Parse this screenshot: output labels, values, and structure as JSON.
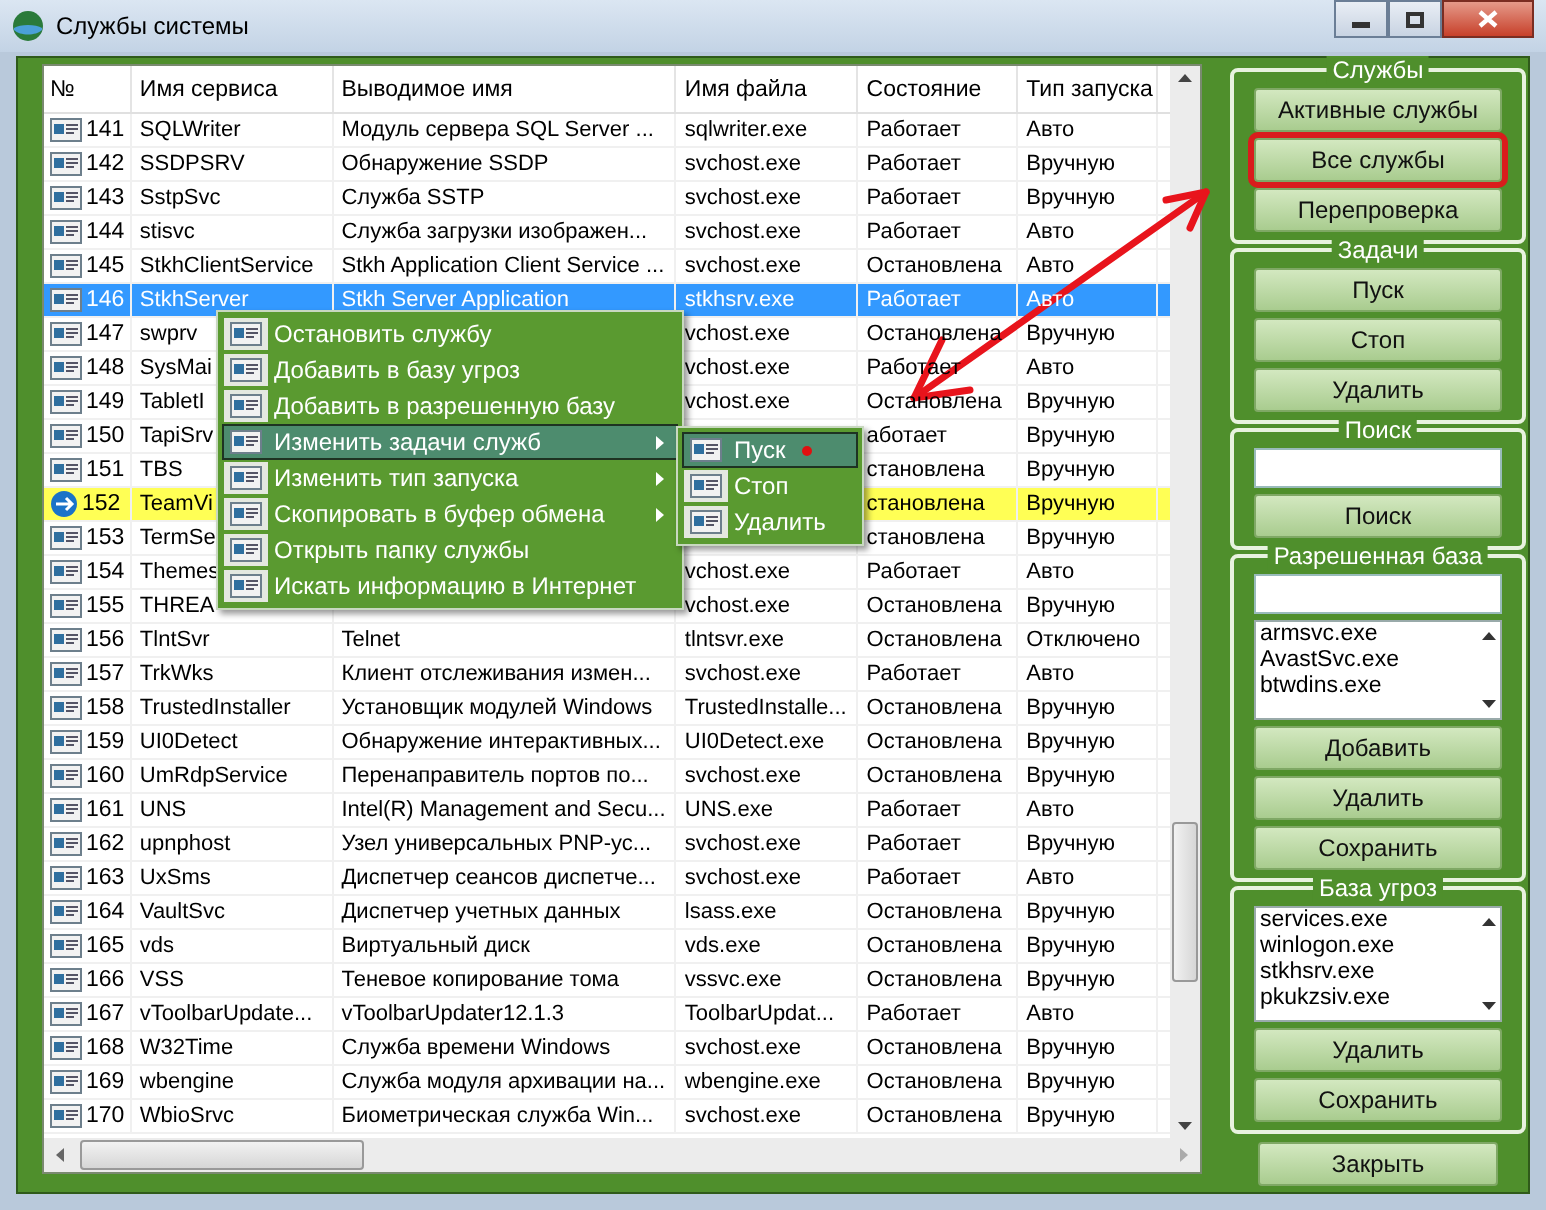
{
  "window": {
    "title": "Службы системы"
  },
  "table": {
    "columns": [
      "№",
      "Имя сервиса",
      "Выводимое имя",
      "Имя файла",
      "Состояние",
      "Тип запуска"
    ],
    "rows": [
      {
        "no": "141",
        "kind": "service",
        "name": "SQLWriter",
        "display": "Модуль сервера SQL Server ...",
        "file": "sqlwriter.exe",
        "state": "Работает",
        "startup": "Авто",
        "selected": false,
        "highlighted": false
      },
      {
        "no": "142",
        "kind": "service",
        "name": "SSDPSRV",
        "display": "Обнаружение SSDP",
        "file": "svchost.exe",
        "state": "Работает",
        "startup": "Вручную",
        "selected": false,
        "highlighted": false
      },
      {
        "no": "143",
        "kind": "service",
        "name": "SstpSvc",
        "display": "Служба SSTP",
        "file": "svchost.exe",
        "state": "Работает",
        "startup": "Вручную",
        "selected": false,
        "highlighted": false
      },
      {
        "no": "144",
        "kind": "service",
        "name": "stisvc",
        "display": "Служба загрузки изображен...",
        "file": "svchost.exe",
        "state": "Работает",
        "startup": "Авто",
        "selected": false,
        "highlighted": false
      },
      {
        "no": "145",
        "kind": "service",
        "name": "StkhClientService",
        "display": "Stkh Application Client Service ...",
        "file": "svchost.exe",
        "state": "Остановлена",
        "startup": "Авто",
        "selected": false,
        "highlighted": false
      },
      {
        "no": "146",
        "kind": "service",
        "name": "StkhServer",
        "display": "Stkh Server Application",
        "file": "stkhsrv.exe",
        "state": "Работает",
        "startup": "Авто",
        "selected": true,
        "highlighted": false
      },
      {
        "no": "147",
        "kind": "service",
        "name": "swprv",
        "file": "vchost.exe",
        "state": "Остановлена",
        "startup": "Вручную",
        "selected": false,
        "highlighted": false
      },
      {
        "no": "148",
        "kind": "service",
        "name": "SysMai",
        "file": "vchost.exe",
        "state": "Работает",
        "startup": "Авто",
        "selected": false,
        "highlighted": false
      },
      {
        "no": "149",
        "kind": "service",
        "name": "TabletI",
        "file": "vchost.exe",
        "state": "Остановлена",
        "startup": "Вручную",
        "selected": false,
        "highlighted": false
      },
      {
        "no": "150",
        "kind": "service",
        "name": "TapiSrv",
        "state": "аботает",
        "startup": "Вручную",
        "selected": false,
        "highlighted": false
      },
      {
        "no": "151",
        "kind": "service",
        "name": "TBS",
        "state": "становлена",
        "startup": "Вручную",
        "selected": false,
        "highlighted": false
      },
      {
        "no": "152",
        "kind": "app",
        "name": "TeamVi",
        "state": "становлена",
        "startup": "Вручную",
        "selected": false,
        "highlighted": true
      },
      {
        "no": "153",
        "kind": "service",
        "name": "TermSe",
        "state": "становлена",
        "startup": "Вручную",
        "selected": false,
        "highlighted": false
      },
      {
        "no": "154",
        "kind": "service",
        "name": "Themes",
        "file": "vchost.exe",
        "state": "Работает",
        "startup": "Авто",
        "selected": false,
        "highlighted": false
      },
      {
        "no": "155",
        "kind": "service",
        "name": "THREA",
        "file": "vchost.exe",
        "state": "Остановлена",
        "startup": "Вручную",
        "selected": false,
        "highlighted": false
      },
      {
        "no": "156",
        "kind": "service",
        "name": "TlntSvr",
        "display": "Telnet",
        "file": "tlntsvr.exe",
        "state": "Остановлена",
        "startup": "Отключено",
        "selected": false,
        "highlighted": false
      },
      {
        "no": "157",
        "kind": "service",
        "name": "TrkWks",
        "display": "Клиент отслеживания измен...",
        "file": "svchost.exe",
        "state": "Работает",
        "startup": "Авто",
        "selected": false,
        "highlighted": false
      },
      {
        "no": "158",
        "kind": "service",
        "name": "TrustedInstaller",
        "display": "Установщик модулей Windows",
        "file": "TrustedInstalle...",
        "state": "Остановлена",
        "startup": "Вручную",
        "selected": false,
        "highlighted": false
      },
      {
        "no": "159",
        "kind": "service",
        "name": "UI0Detect",
        "display": "Обнаружение интерактивных...",
        "file": "UI0Detect.exe",
        "state": "Остановлена",
        "startup": "Вручную",
        "selected": false,
        "highlighted": false
      },
      {
        "no": "160",
        "kind": "service",
        "name": "UmRdpService",
        "display": "Перенаправитель портов по...",
        "file": "svchost.exe",
        "state": "Остановлена",
        "startup": "Вручную",
        "selected": false,
        "highlighted": false
      },
      {
        "no": "161",
        "kind": "service",
        "name": "UNS",
        "display": "Intel(R) Management and Secu...",
        "file": "UNS.exe",
        "state": "Работает",
        "startup": "Авто",
        "selected": false,
        "highlighted": false
      },
      {
        "no": "162",
        "kind": "service",
        "name": "upnphost",
        "display": "Узел универсальных PNP-ус...",
        "file": "svchost.exe",
        "state": "Работает",
        "startup": "Вручную",
        "selected": false,
        "highlighted": false
      },
      {
        "no": "163",
        "kind": "service",
        "name": "UxSms",
        "display": "Диспетчер сеансов диспетче...",
        "file": "svchost.exe",
        "state": "Работает",
        "startup": "Авто",
        "selected": false,
        "highlighted": false
      },
      {
        "no": "164",
        "kind": "service",
        "name": "VaultSvc",
        "display": "Диспетчер учетных данных",
        "file": "lsass.exe",
        "state": "Остановлена",
        "startup": "Вручную",
        "selected": false,
        "highlighted": false
      },
      {
        "no": "165",
        "kind": "service",
        "name": "vds",
        "display": "Виртуальный диск",
        "file": "vds.exe",
        "state": "Остановлена",
        "startup": "Вручную",
        "selected": false,
        "highlighted": false
      },
      {
        "no": "166",
        "kind": "service",
        "name": "VSS",
        "display": "Теневое копирование тома",
        "file": "vssvc.exe",
        "state": "Остановлена",
        "startup": "Вручную",
        "selected": false,
        "highlighted": false
      },
      {
        "no": "167",
        "kind": "service",
        "name": "vToolbarUpdate...",
        "display": "vToolbarUpdater12.1.3",
        "file": "ToolbarUpdat...",
        "state": "Работает",
        "startup": "Авто",
        "selected": false,
        "highlighted": false
      },
      {
        "no": "168",
        "kind": "service",
        "name": "W32Time",
        "display": "Служба времени Windows",
        "file": "svchost.exe",
        "state": "Остановлена",
        "startup": "Вручную",
        "selected": false,
        "highlighted": false
      },
      {
        "no": "169",
        "kind": "service",
        "name": "wbengine",
        "display": "Служба модуля архивации на...",
        "file": "wbengine.exe",
        "state": "Остановлена",
        "startup": "Вручную",
        "selected": false,
        "highlighted": false
      },
      {
        "no": "170",
        "kind": "service",
        "name": "WbioSrvc",
        "display": "Биометрическая служба Win...",
        "file": "svchost.exe",
        "state": "Остановлена",
        "startup": "Вручную",
        "selected": false,
        "highlighted": false
      }
    ]
  },
  "context_menu": {
    "items": [
      {
        "label": "Остановить службу",
        "submenu": false,
        "highlighted": false
      },
      {
        "label": "Добавить в базу угроз",
        "submenu": false,
        "highlighted": false
      },
      {
        "label": "Добавить в разрешенную базу",
        "submenu": false,
        "highlighted": false
      },
      {
        "label": "Изменить задачи служб",
        "submenu": true,
        "highlighted": true
      },
      {
        "label": "Изменить тип запуска",
        "submenu": true,
        "highlighted": false
      },
      {
        "label": "Скопировать в буфер обмена",
        "submenu": true,
        "highlighted": false
      },
      {
        "label": "Открыть папку службы",
        "submenu": false,
        "highlighted": false
      },
      {
        "label": "Искать информацию в Интернет",
        "submenu": false,
        "highlighted": false
      }
    ],
    "submenu": [
      {
        "label": "Пуск",
        "highlighted": true
      },
      {
        "label": "Стоп",
        "highlighted": false
      },
      {
        "label": "Удалить",
        "highlighted": false
      }
    ]
  },
  "side_panel": {
    "groups": [
      {
        "title": "Службы",
        "items": [
          {
            "kind": "button",
            "label": "Активные службы",
            "annotated": false
          },
          {
            "kind": "button",
            "label": "Все службы",
            "annotated": true
          },
          {
            "kind": "button",
            "label": "Перепроверка",
            "annotated": false
          }
        ]
      },
      {
        "title": "Задачи",
        "items": [
          {
            "kind": "button",
            "label": "Пуск",
            "annotated": false
          },
          {
            "kind": "button",
            "label": "Стоп",
            "annotated": false
          },
          {
            "kind": "button",
            "label": "Удалить",
            "annotated": false
          }
        ]
      },
      {
        "title": "Поиск",
        "items": [
          {
            "kind": "field"
          },
          {
            "kind": "button",
            "label": "Поиск",
            "annotated": false
          }
        ]
      },
      {
        "title": "Разрешенная база",
        "items": [
          {
            "kind": "field"
          },
          {
            "kind": "listbox",
            "entries": [
              "armsvc.exe",
              "AvastSvc.exe",
              "btwdins.exe"
            ]
          },
          {
            "kind": "button",
            "label": "Добавить",
            "annotated": false
          },
          {
            "kind": "button",
            "label": "Удалить",
            "annotated": false
          },
          {
            "kind": "button",
            "label": "Сохранить",
            "annotated": false
          }
        ]
      },
      {
        "title": "База угроз",
        "items": [
          {
            "kind": "listbox",
            "entries": [
              "services.exe",
              "winlogon.exe",
              "stkhsrv.exe",
              "pkukzsiv.exe"
            ]
          },
          {
            "kind": "button",
            "label": "Удалить",
            "annotated": false
          },
          {
            "kind": "button",
            "label": "Сохранить",
            "annotated": false
          }
        ]
      }
    ],
    "close_button": "Закрыть"
  }
}
